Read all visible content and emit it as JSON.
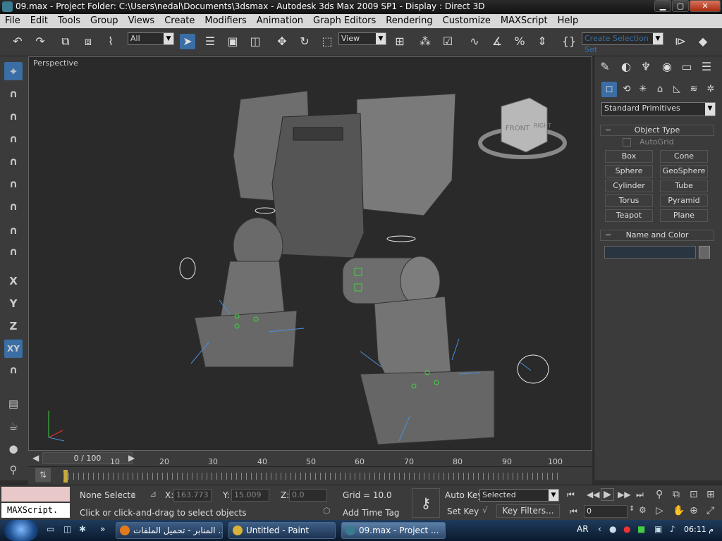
{
  "window": {
    "title": "09.max     - Project Folder: C:\\Users\\nedal\\Documents\\3dsmax      - Autodesk 3ds Max  2009 SP1         - Display : Direct 3D",
    "minimize": "▁",
    "maximize": "▢",
    "close": "✕"
  },
  "menu": [
    "File",
    "Edit",
    "Tools",
    "Group",
    "Views",
    "Create",
    "Modifiers",
    "Animation",
    "Graph Editors",
    "Rendering",
    "Customize",
    "MAXScript",
    "Help"
  ],
  "toolbar": {
    "selection_filter": "All",
    "reference_coord": "View",
    "named_selection_placeholder": "Create Selection Set"
  },
  "viewport": {
    "label": "Perspective",
    "viewcube_front": "FRONT",
    "viewcube_right": "RIGHT"
  },
  "axis_tools": [
    "X",
    "Y",
    "Z",
    "XY"
  ],
  "command_panel": {
    "category": "Standard Primitives",
    "object_type_title": "Object Type",
    "autogrid": "AutoGrid",
    "buttons": [
      "Box",
      "Cone",
      "Sphere",
      "GeoSphere",
      "Cylinder",
      "Tube",
      "Torus",
      "Pyramid",
      "Teapot",
      "Plane"
    ],
    "name_color_title": "Name and Color",
    "rollout_toggle": "−"
  },
  "timeline": {
    "frame": "0 / 100",
    "ticks": [
      "10",
      "20",
      "30",
      "40",
      "50",
      "60",
      "70",
      "80",
      "90",
      "100"
    ]
  },
  "status": {
    "maxscript": "MAXScript.",
    "selection": "None Selecte",
    "x_label": "X:",
    "x_value": "163.773",
    "y_label": "Y:",
    "y_value": "15.009",
    "z_label": "Z:",
    "z_value": "0.0",
    "grid": "Grid = 10.0",
    "auto_key": "Auto Key",
    "key_mode": "Selected",
    "set_key": "Set Key",
    "key_filters": "Key Filters...",
    "prompt": "Click or click-and-drag to select objects",
    "add_time_tag": "Add Time Tag",
    "current_frame": "0"
  },
  "taskbar": {
    "items": [
      "المنابر - تحميل الملفات ...",
      "Untitled - Paint",
      "09.max     - Project ..."
    ],
    "lang": "AR",
    "time": "06:11 م"
  },
  "colors": {
    "accent": "#3a6ea5",
    "viewport_bg": "#2a2a2a",
    "panel_bg": "#3b3b3b"
  }
}
